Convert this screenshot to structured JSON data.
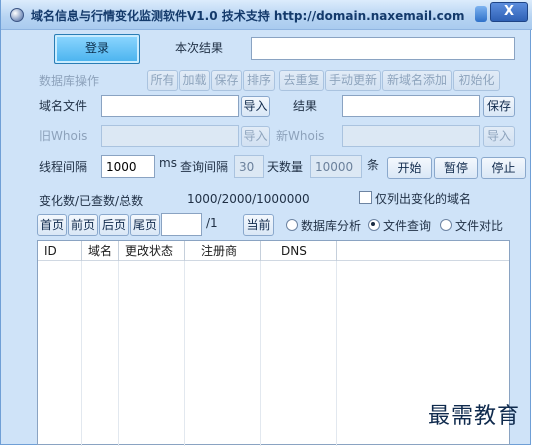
{
  "window": {
    "title": "域名信息与行情变化监测软件V1.0 技术支持 http://domain.naxemail.com",
    "close_label": "X"
  },
  "top": {
    "login_label": "登录",
    "result_label": "本次结果",
    "result_value": ""
  },
  "db_ops": {
    "section_label": "数据库操作",
    "buttons": [
      "所有",
      "加载",
      "保存",
      "排序",
      "去重复",
      "手动更新",
      "新域名添加",
      "初始化"
    ]
  },
  "domain_file": {
    "label": "域名文件",
    "value": "",
    "import_label": "导入"
  },
  "result_file": {
    "label": "结果",
    "value": "",
    "save_label": "保存"
  },
  "old_whois": {
    "label": "旧Whois",
    "value": "",
    "import_label": "导入"
  },
  "new_whois": {
    "label": "新Whois",
    "value": "",
    "import_label": "导入"
  },
  "params": {
    "thread_interval_label": "线程间隔",
    "thread_interval_value": "1000",
    "ms_label": "ms",
    "query_interval_label": "查询间隔",
    "query_interval_value": "30",
    "day_count_label": "天数量",
    "day_count_value": "10000",
    "unit_label": "条",
    "start_label": "开始",
    "pause_label": "暂停",
    "stop_label": "停止"
  },
  "stats": {
    "label": "变化数/已查数/总数",
    "value": "1000/2000/1000000",
    "only_changed_label": "仅列出变化的域名",
    "only_changed_checked": false
  },
  "pager": {
    "first_label": "首页",
    "prev_label": "前页",
    "next_label": "后页",
    "last_label": "尾页",
    "page_value": "",
    "total_label": "/1",
    "current_label": "当前"
  },
  "modes": {
    "options": [
      "数据库分析",
      "文件查询",
      "文件对比"
    ],
    "selected": "文件查询"
  },
  "table": {
    "columns": [
      "ID",
      "域名",
      "更改状态",
      "注册商",
      "DNS"
    ],
    "rows": []
  },
  "watermark": "最需教育"
}
